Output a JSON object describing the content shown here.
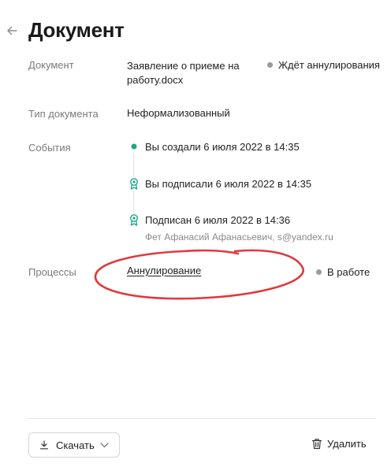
{
  "page": {
    "title": "Документ"
  },
  "details": {
    "document": {
      "label": "Документ",
      "value": "Заявление о приеме на работу.docx",
      "status": "Ждёт аннулирования"
    },
    "doc_type": {
      "label": "Тип документа",
      "value": "Неформализованный"
    },
    "events": {
      "label": "События",
      "items": [
        {
          "text": "Вы создали 6 июля 2022 в 14:35",
          "icon": "dot"
        },
        {
          "text": "Вы подписали 6 июля 2022 в 14:35",
          "icon": "badge-icon"
        },
        {
          "text": "Подписан 6 июля 2022 в 14:36",
          "sub": "Фет Афанасий Афанасьевич, s@yandex.ru",
          "icon": "badge-icon"
        }
      ]
    },
    "processes": {
      "label": "Процессы",
      "link": "Аннулирование",
      "status": "В работе"
    }
  },
  "footer": {
    "download_label": "Скачать",
    "delete_label": "Удалить"
  },
  "colors": {
    "accent": "#1aa58a",
    "status_dot": "#9a9a9a",
    "annotation": "#e0393e"
  }
}
